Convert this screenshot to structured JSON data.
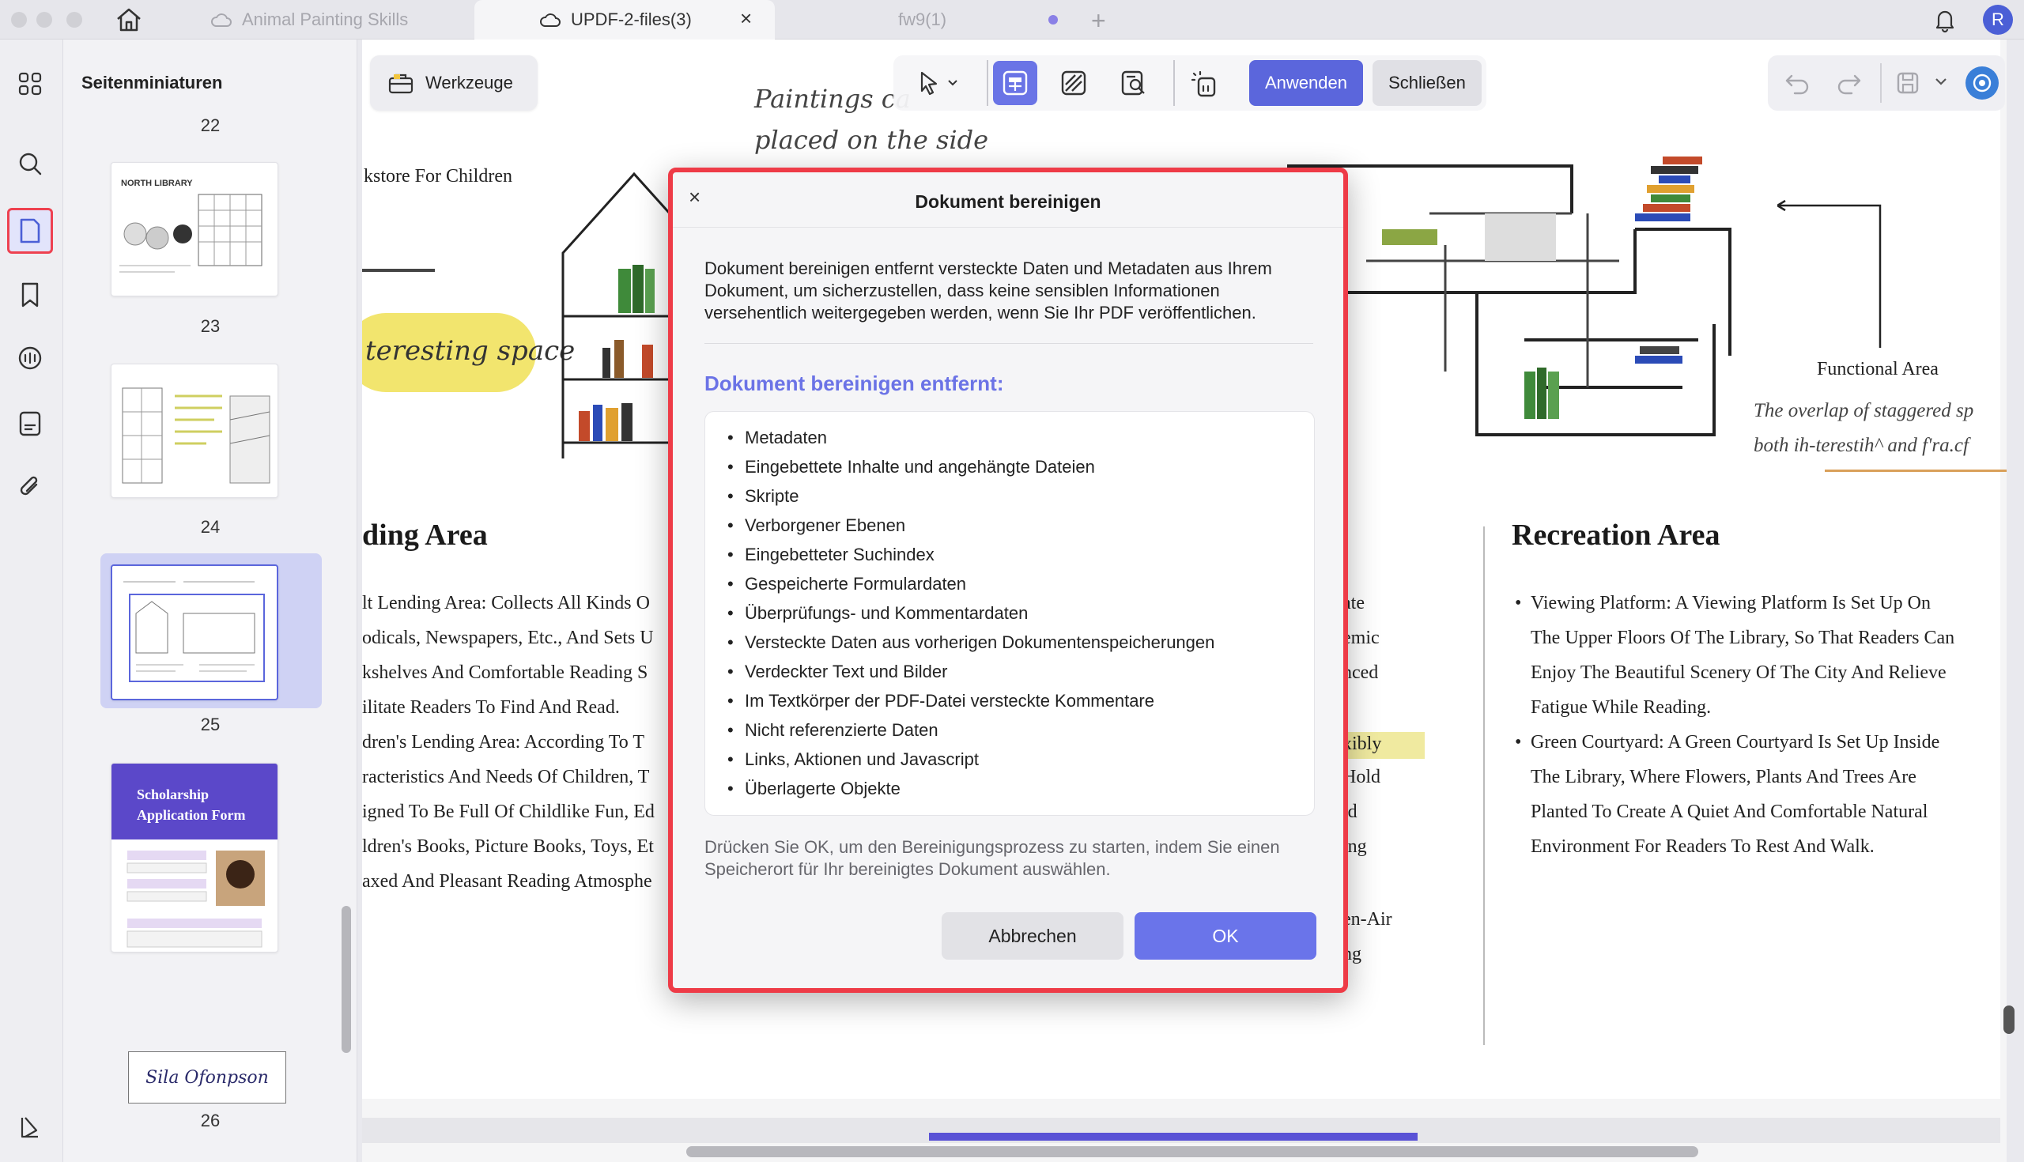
{
  "tabs": [
    {
      "label": "Animal Painting Skills",
      "state": "inactive"
    },
    {
      "label": "UPDF-2-files(3)",
      "state": "active"
    },
    {
      "label": "fw9(1)",
      "state": "inactive"
    }
  ],
  "user_initial": "R",
  "sidebar": {
    "title": "Seitenminiaturen",
    "pages": [
      "22",
      "23",
      "24",
      "25",
      "26"
    ]
  },
  "toolbar": {
    "tools_label": "Werkzeuge",
    "apply_label": "Anwenden",
    "close_label": "Schließen"
  },
  "document": {
    "handwritten_top": [
      "Paintings ca",
      "placed on the side"
    ],
    "bookstore": "kstore For Children",
    "interesting": "teresting space",
    "functional": "Functional Area",
    "overlap": [
      "The overlap of staggered sp",
      "both ih-terestih^ and f'ra.cf"
    ],
    "lending_heading": "ding Area",
    "lending_lines": [
      "lt Lending Area: Collects All Kinds O",
      "odicals, Newspapers, Etc., And Sets U",
      "kshelves And Comfortable Reading S",
      "ilitate Readers To Find And Read.",
      "dren's Lending Area: According To T",
      "racteristics And Needs Of Children, T",
      "igned To Be Full Of Childlike Fun, Ed",
      "ldren's Books, Picture Books, Toys, Et",
      "axed And Pleasant Reading Atmosphe"
    ],
    "mid_fragments": [
      "ate",
      "emic",
      "nced",
      "xibly",
      "Hold",
      "ld",
      "ing",
      "en-Air",
      "ng"
    ],
    "recreation_heading": "Recreation Area",
    "recreation_lines": [
      "Viewing Platform: A Viewing Platform Is Set Up On",
      "The Upper Floors Of The Library, So That Readers Can",
      "Enjoy The Beautiful Scenery Of The City And Relieve",
      "Fatigue While Reading.",
      "Green Courtyard: A Green Courtyard Is Set Up Inside",
      "The Library, Where Flowers, Plants And Trees Are",
      "Planted To Create A Quiet And Comfortable Natural",
      "Environment For Readers To Rest And Walk."
    ],
    "thumb23_title": "NORTH LIBRARY",
    "thumb26_title": "Scholarship Application Form",
    "thumb26_signature": "Sila Ofonpson"
  },
  "dialog": {
    "title": "Dokument bereinigen",
    "intro": "Dokument bereinigen entfernt versteckte Daten und Metadaten aus Ihrem Dokument, um sicherzustellen, dass keine sensiblen Informationen versehentlich weitergegeben werden, wenn Sie Ihr PDF veröffentlichen.",
    "subtitle": "Dokument bereinigen entfernt:",
    "items": [
      "Metadaten",
      "Eingebettete Inhalte und angehängte Dateien",
      "Skripte",
      "Verborgener Ebenen",
      "Eingebetteter Suchindex",
      "Gespeicherte Formulardaten",
      "Überprüfungs- und Kommentardaten",
      "Versteckte Daten aus vorherigen Dokumentenspeicherungen",
      "Verdeckter Text und Bilder",
      "Im Textkörper der PDF-Datei versteckte Kommentare",
      "Nicht referenzierte Daten",
      "Links, Aktionen und Javascript",
      "Überlagerte Objekte"
    ],
    "footer": "Drücken Sie OK, um den Bereinigungsprozess zu starten, indem Sie einen Speicherort für Ihr bereinigtes Dokument auswählen.",
    "cancel_label": "Abbrechen",
    "ok_label": "OK"
  },
  "colors": {
    "accent": "#5b66dc",
    "highlight": "#ee3b47"
  }
}
